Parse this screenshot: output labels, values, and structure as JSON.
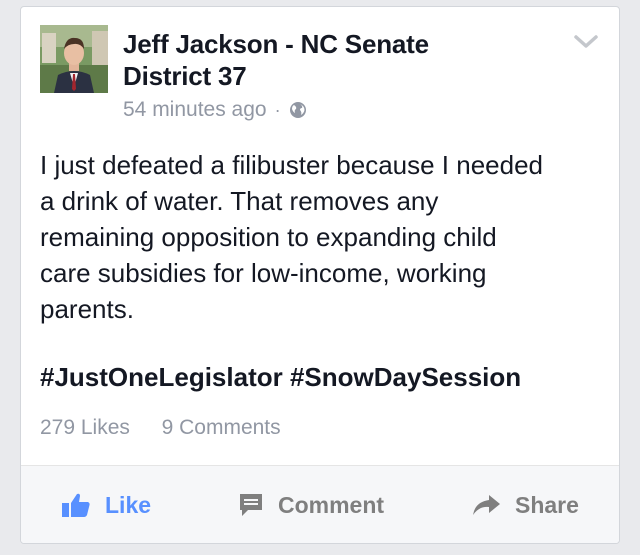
{
  "post": {
    "author_line1": "Jeff Jackson - NC Senate",
    "author_line2": "District 37",
    "timestamp": "54 minutes ago",
    "separator": "·",
    "privacy_icon": "globe-icon",
    "body_lines": [
      "I just defeated a filibuster because I needed",
      "a drink of water. That removes any",
      "remaining opposition to expanding child",
      "care subsidies for low-income, working",
      "parents."
    ],
    "hashtag_1": "#JustOneLegislator",
    "hashtag_2": "#SnowDaySession"
  },
  "stats": {
    "likes": "279 Likes",
    "comments": "9 Comments"
  },
  "actions": {
    "like_label": "Like",
    "comment_label": "Comment",
    "share_label": "Share"
  },
  "colors": {
    "like_blue": "#5890ff",
    "text": "#141823",
    "muted": "#9197a3",
    "action_gray": "#7f7f7f"
  }
}
